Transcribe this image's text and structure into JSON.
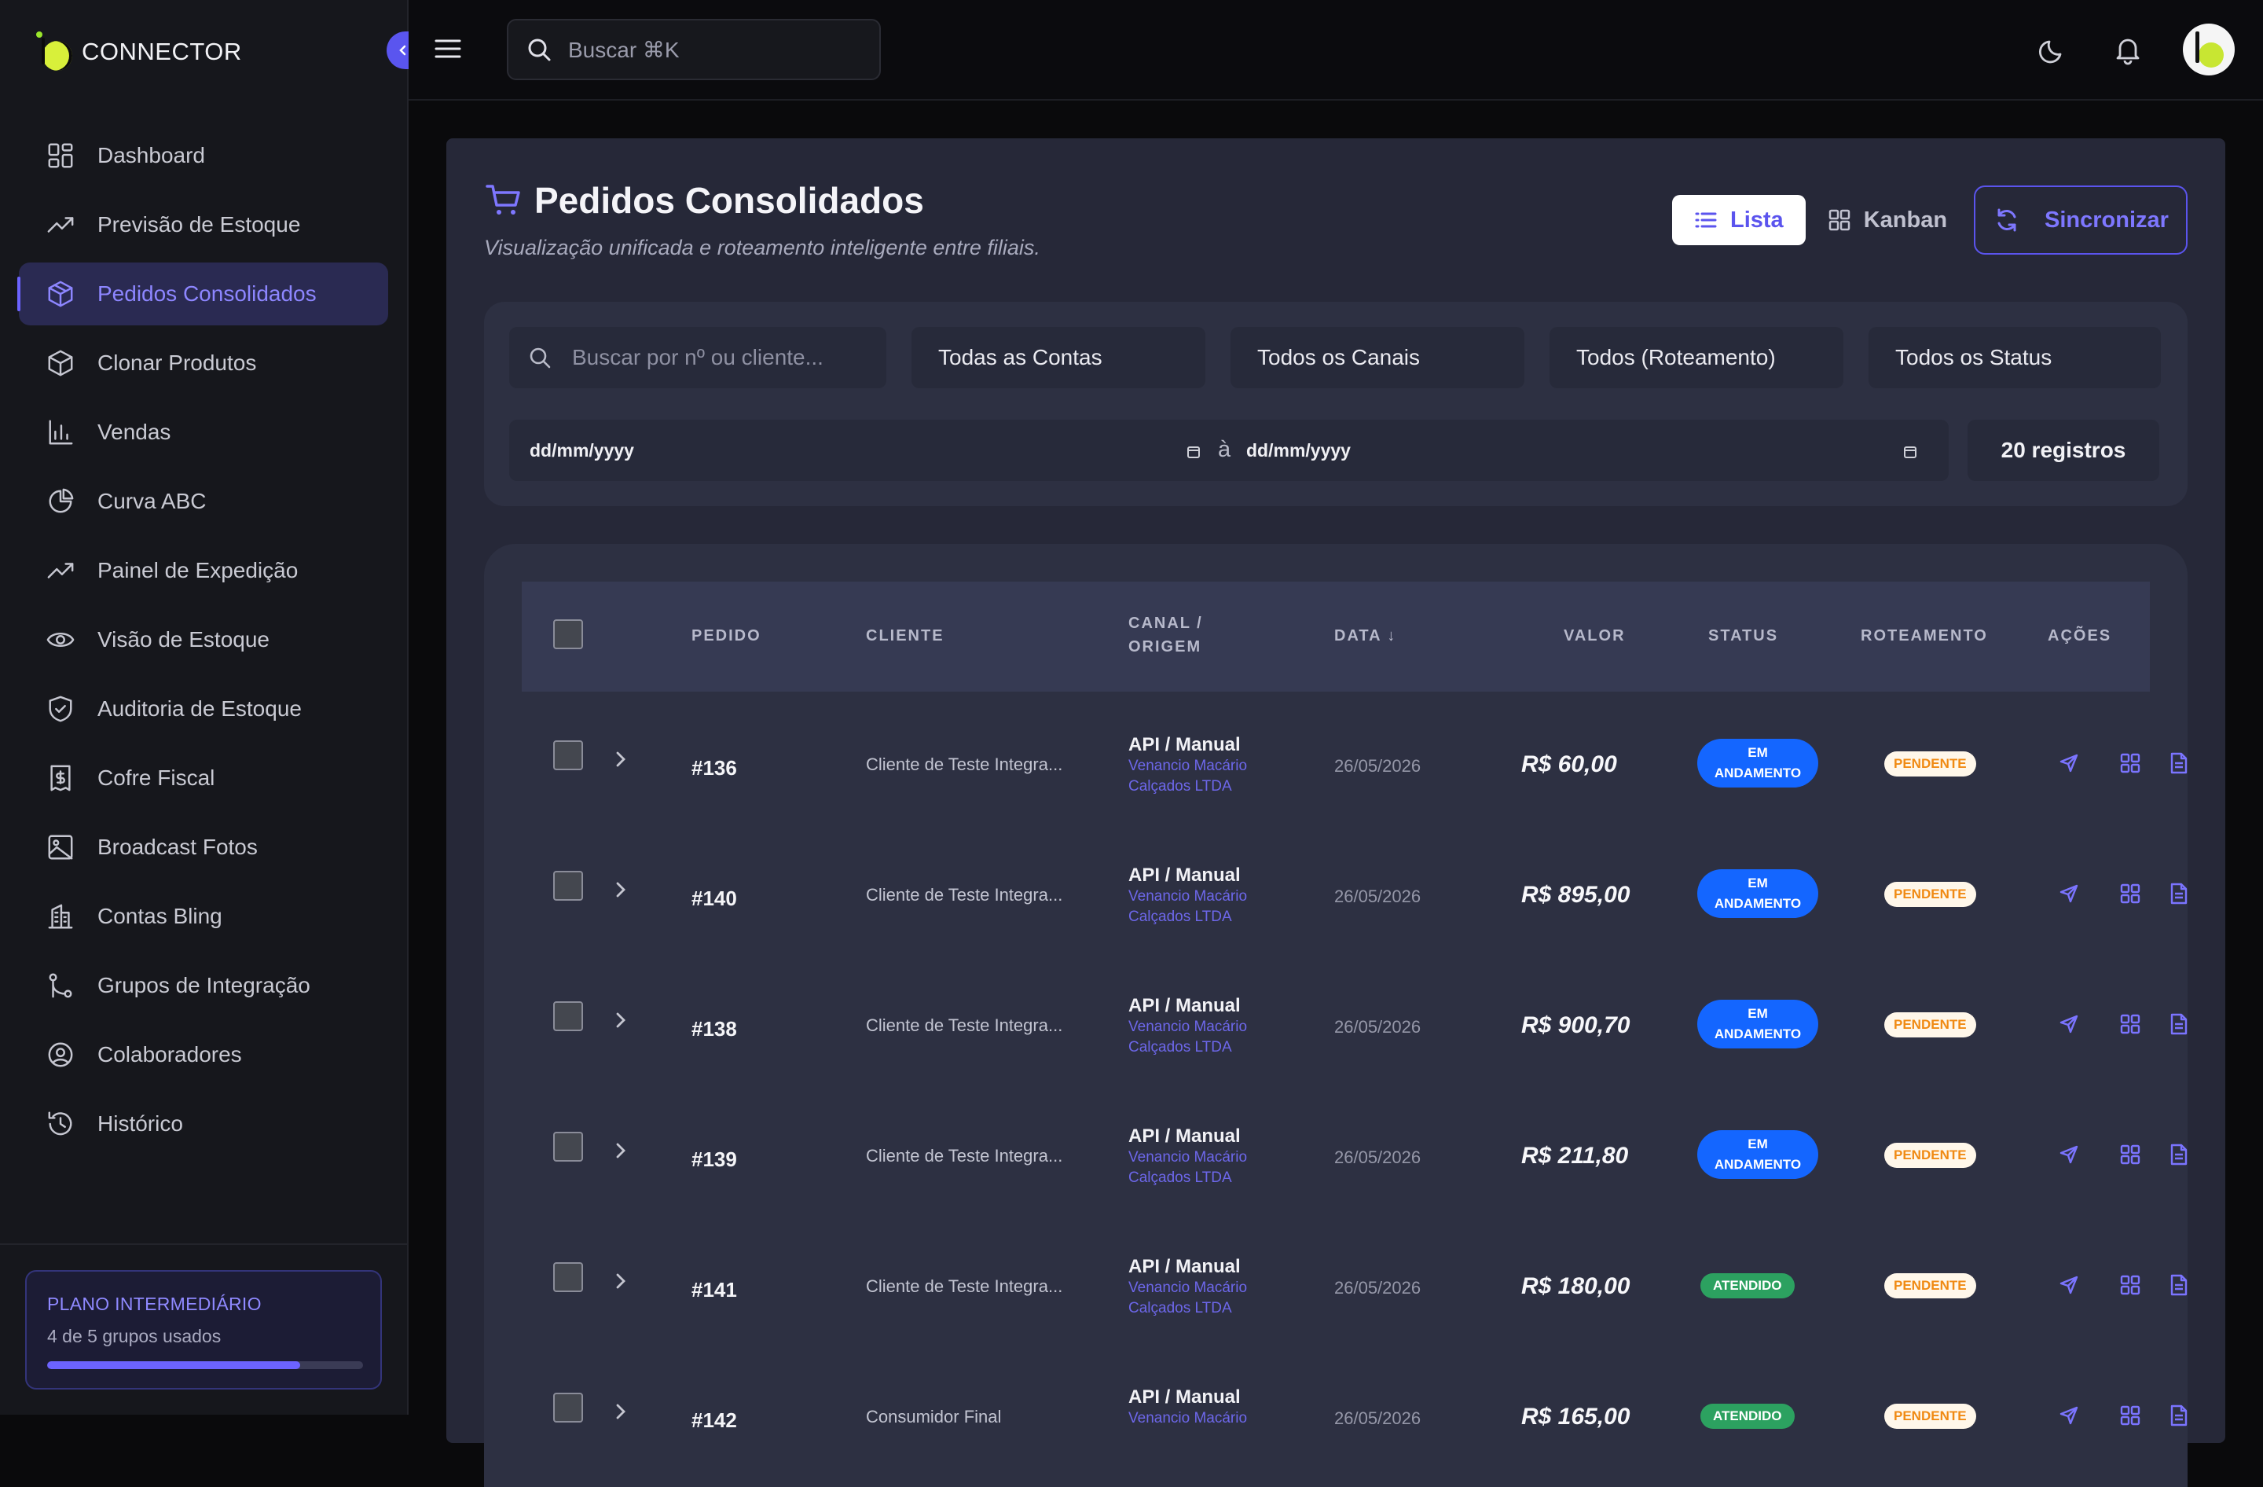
{
  "app": {
    "logo_text": "CONNECTOR"
  },
  "sidebar": {
    "items": [
      {
        "label": "Dashboard",
        "icon": "dashboard-grid-icon",
        "active": false
      },
      {
        "label": "Previsão de Estoque",
        "icon": "trending-up-icon",
        "active": false
      },
      {
        "label": "Pedidos Consolidados",
        "icon": "package-icon",
        "active": true
      },
      {
        "label": "Clonar Produtos",
        "icon": "box-icon",
        "active": false
      },
      {
        "label": "Vendas",
        "icon": "bar-chart-icon",
        "active": false
      },
      {
        "label": "Curva ABC",
        "icon": "pie-chart-icon",
        "active": false
      },
      {
        "label": "Painel de Expedição",
        "icon": "trending-up-icon",
        "active": false
      },
      {
        "label": "Visão de Estoque",
        "icon": "eye-icon",
        "active": false
      },
      {
        "label": "Auditoria de Estoque",
        "icon": "shield-check-icon",
        "active": false
      },
      {
        "label": "Cofre Fiscal",
        "icon": "receipt-icon",
        "active": false
      },
      {
        "label": "Broadcast Fotos",
        "icon": "image-icon",
        "active": false
      },
      {
        "label": "Contas Bling",
        "icon": "building-icon",
        "active": false
      },
      {
        "label": "Grupos de Integração",
        "icon": "git-branch-icon",
        "active": false
      },
      {
        "label": "Colaboradores",
        "icon": "user-circle-icon",
        "active": false
      },
      {
        "label": "Histórico",
        "icon": "history-icon",
        "active": false
      }
    ],
    "plan": {
      "title": "PLANO INTERMEDIÁRIO",
      "usage": "4 de 5 grupos usados",
      "used": 4,
      "total": 5
    }
  },
  "topbar": {
    "search_placeholder": "Buscar ⌘K"
  },
  "page": {
    "title": "Pedidos Consolidados",
    "subtitle": "Visualização unificada e roteamento inteligente entre filiais.",
    "view_list": "Lista",
    "view_kanban": "Kanban",
    "sync": "Sincronizar"
  },
  "filters": {
    "search_placeholder": "Buscar por nº ou cliente...",
    "accounts": "Todas as Contas",
    "channels": "Todos os Canais",
    "routing": "Todos (Roteamento)",
    "status": "Todos os Status",
    "date_from": "dd/mm/yyyy",
    "date_sep": "à",
    "date_to": "dd/mm/yyyy",
    "count": "20 registros"
  },
  "table": {
    "headers": {
      "order": "PEDIDO",
      "client": "CLIENTE",
      "channel_1": "CANAL /",
      "channel_2": "ORIGEM",
      "date": "DATA ↓",
      "value": "VALOR",
      "status": "STATUS",
      "routing": "ROTEAMENTO",
      "actions": "AÇÕES"
    },
    "rows": [
      {
        "order": "#136",
        "client": "Cliente de Teste Integra...",
        "channel": "API / Manual",
        "origin_1": "Venancio Macário",
        "origin_2": "Calçados LTDA",
        "date": "26/05/2026",
        "value": "R$ 60,00",
        "status_1": "EM",
        "status_2": "ANDAMENTO",
        "status_type": "blue",
        "routing": "PENDENTE"
      },
      {
        "order": "#140",
        "client": "Cliente de Teste Integra...",
        "channel": "API / Manual",
        "origin_1": "Venancio Macário",
        "origin_2": "Calçados LTDA",
        "date": "26/05/2026",
        "value": "R$ 895,00",
        "status_1": "EM",
        "status_2": "ANDAMENTO",
        "status_type": "blue",
        "routing": "PENDENTE"
      },
      {
        "order": "#138",
        "client": "Cliente de Teste Integra...",
        "channel": "API / Manual",
        "origin_1": "Venancio Macário",
        "origin_2": "Calçados LTDA",
        "date": "26/05/2026",
        "value": "R$ 900,70",
        "status_1": "EM",
        "status_2": "ANDAMENTO",
        "status_type": "blue",
        "routing": "PENDENTE"
      },
      {
        "order": "#139",
        "client": "Cliente de Teste Integra...",
        "channel": "API / Manual",
        "origin_1": "Venancio Macário",
        "origin_2": "Calçados LTDA",
        "date": "26/05/2026",
        "value": "R$ 211,80",
        "status_1": "EM",
        "status_2": "ANDAMENTO",
        "status_type": "blue",
        "routing": "PENDENTE"
      },
      {
        "order": "#141",
        "client": "Cliente de Teste Integra...",
        "channel": "API / Manual",
        "origin_1": "Venancio Macário",
        "origin_2": "Calçados LTDA",
        "date": "26/05/2026",
        "value": "R$ 180,00",
        "status_1": "ATENDIDO",
        "status_2": "",
        "status_type": "green",
        "routing": "PENDENTE"
      },
      {
        "order": "#142",
        "client": "Consumidor Final",
        "channel": "API / Manual",
        "origin_1": "Venancio Macário",
        "origin_2": "",
        "date": "26/05/2026",
        "value": "R$ 165,00",
        "status_1": "ATENDIDO",
        "status_2": "",
        "status_type": "green",
        "routing": "PENDENTE"
      }
    ]
  },
  "colors": {
    "accent": "#6c63ff",
    "blue_badge": "#1466ff",
    "green_badge": "#2ca160",
    "pending_text": "#f08a13"
  }
}
